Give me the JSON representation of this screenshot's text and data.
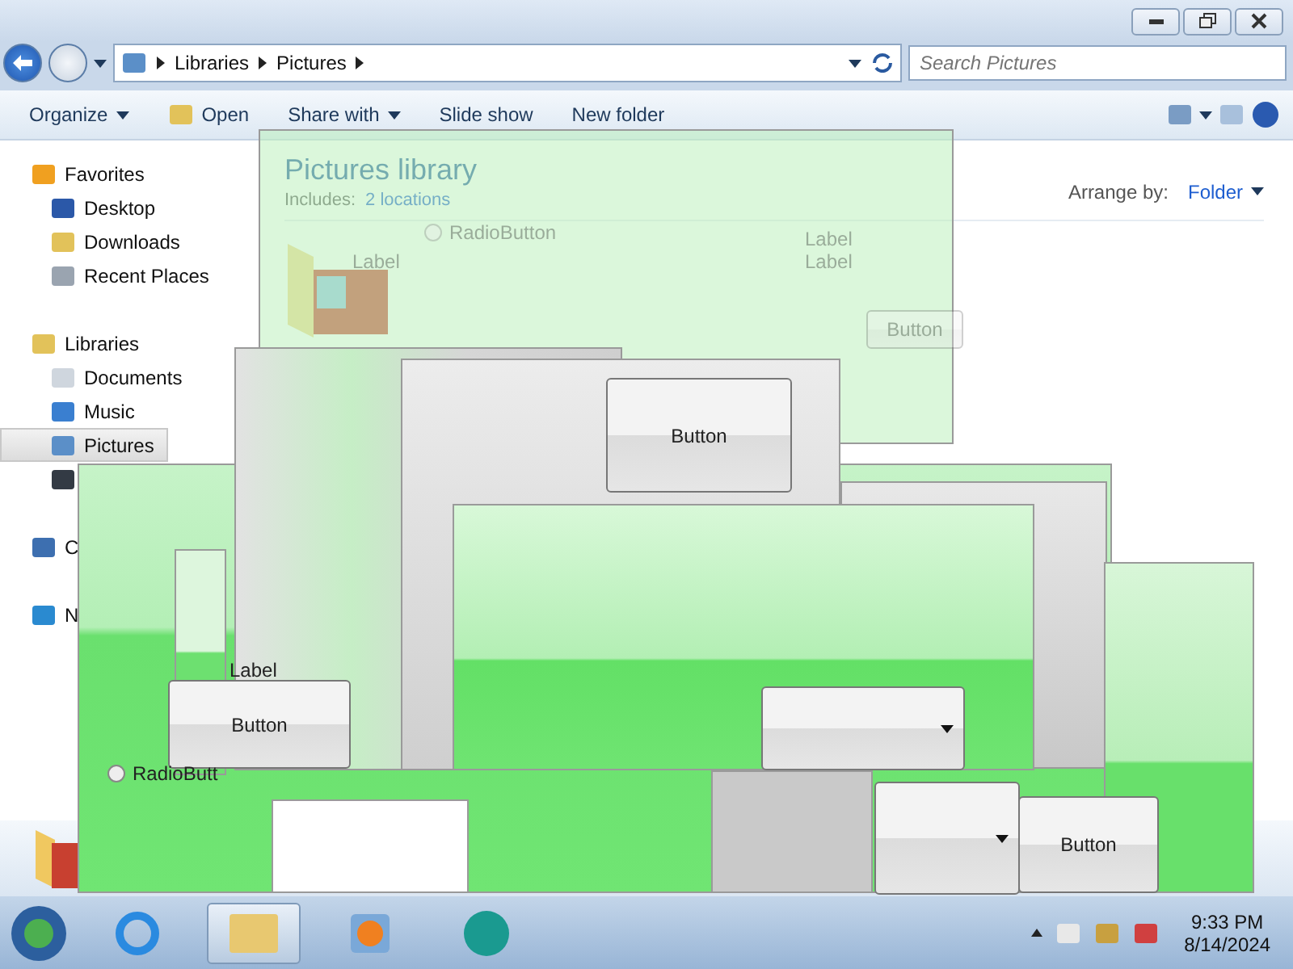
{
  "address": {
    "crumbs": [
      "Libraries",
      "Pictures"
    ],
    "search_placeholder": "Search Pictures"
  },
  "toolbar": [
    {
      "label": "Organize",
      "dropdown": true
    },
    {
      "label": "Open",
      "dropdown": false
    },
    {
      "label": "Share with",
      "dropdown": true
    },
    {
      "label": "Slide show",
      "dropdown": false
    },
    {
      "label": "New folder",
      "dropdown": false
    }
  ],
  "sidebar": [
    {
      "label": "Favorites",
      "children": [
        {
          "label": "Desktop",
          "selected": false
        },
        {
          "label": "Downloads",
          "selected": false
        },
        {
          "label": "Recent Places",
          "selected": false
        }
      ]
    },
    {
      "label": "Libraries",
      "children": [
        {
          "label": "Documents",
          "selected": false
        },
        {
          "label": "Music",
          "selected": false
        },
        {
          "label": "Pictures",
          "selected": true
        }
      ]
    },
    {
      "label": "C"
    },
    {
      "label": "N"
    }
  ],
  "content": {
    "title": "Pictures library",
    "includes_label": "Includes:",
    "includes_link": "2 locations",
    "arrange_label": "Arrange by:",
    "arrange_value": "Folder"
  },
  "ghost_widgets": [
    {
      "kind": "radio",
      "label": "RadioButton",
      "faded": true
    },
    {
      "kind": "label",
      "label": "Label",
      "faded": true
    },
    {
      "kind": "label",
      "label": "Label",
      "faded": true
    },
    {
      "kind": "label",
      "label": "Label",
      "faded": true
    },
    {
      "kind": "button",
      "label": "Button",
      "faded": true
    },
    {
      "kind": "button",
      "label": "Button",
      "faded": false
    },
    {
      "kind": "label",
      "label": "Label",
      "faded": false
    },
    {
      "kind": "button",
      "label": "Button",
      "faded": false
    },
    {
      "kind": "radio",
      "label": "RadioButt",
      "faded": false
    },
    {
      "kind": "combo",
      "faded": false
    },
    {
      "kind": "combo",
      "faded": false
    },
    {
      "kind": "button",
      "label": "Button",
      "faded": false
    }
  ],
  "taskbar": {
    "apps": [
      {
        "selected": false
      },
      {
        "selected": true
      },
      {
        "selected": false
      },
      {
        "selected": false
      }
    ],
    "time": "9:33 PM",
    "date": "8/14/2024"
  }
}
